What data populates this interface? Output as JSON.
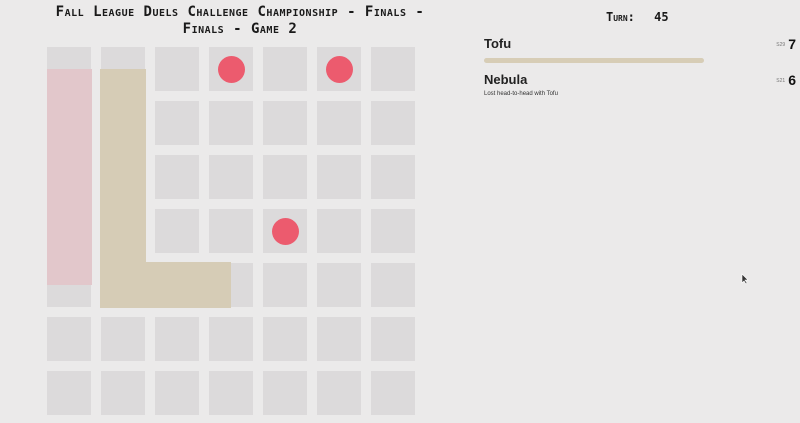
{
  "game": {
    "title_line1": "Fall League Duels Challenge Championship - Finals -",
    "title_line2": "Finals - Game 2",
    "turn_label": "Turn:",
    "turn_value": "45"
  },
  "players": [
    {
      "name": "Tofu",
      "length_small": "S29",
      "length": "7",
      "health_fraction": 1.0,
      "color": "#d6ccb6",
      "status": ""
    },
    {
      "name": "Nebula",
      "length_small": "S21",
      "length": "6",
      "health_fraction": 0.0,
      "color": "#e2c7cb",
      "status": "Lost head-to-head with Tofu"
    }
  ],
  "board": {
    "columns": 7,
    "rows": 7,
    "cell_color": "#dcdadb",
    "food_color": "#ec5b6e",
    "food": [
      [
        3,
        0
      ],
      [
        5,
        0
      ],
      [
        4,
        3
      ]
    ],
    "snakes": [
      {
        "owner": "Nebula",
        "body": [
          [
            0,
            4
          ],
          [
            0,
            3
          ],
          [
            0,
            2
          ],
          [
            0,
            1
          ],
          [
            0,
            0
          ]
        ]
      },
      {
        "owner": "Tofu",
        "body": [
          [
            1,
            0
          ],
          [
            1,
            1
          ],
          [
            1,
            2
          ],
          [
            1,
            3
          ],
          [
            1,
            4
          ],
          [
            2,
            4
          ],
          [
            3,
            4
          ]
        ]
      }
    ]
  }
}
